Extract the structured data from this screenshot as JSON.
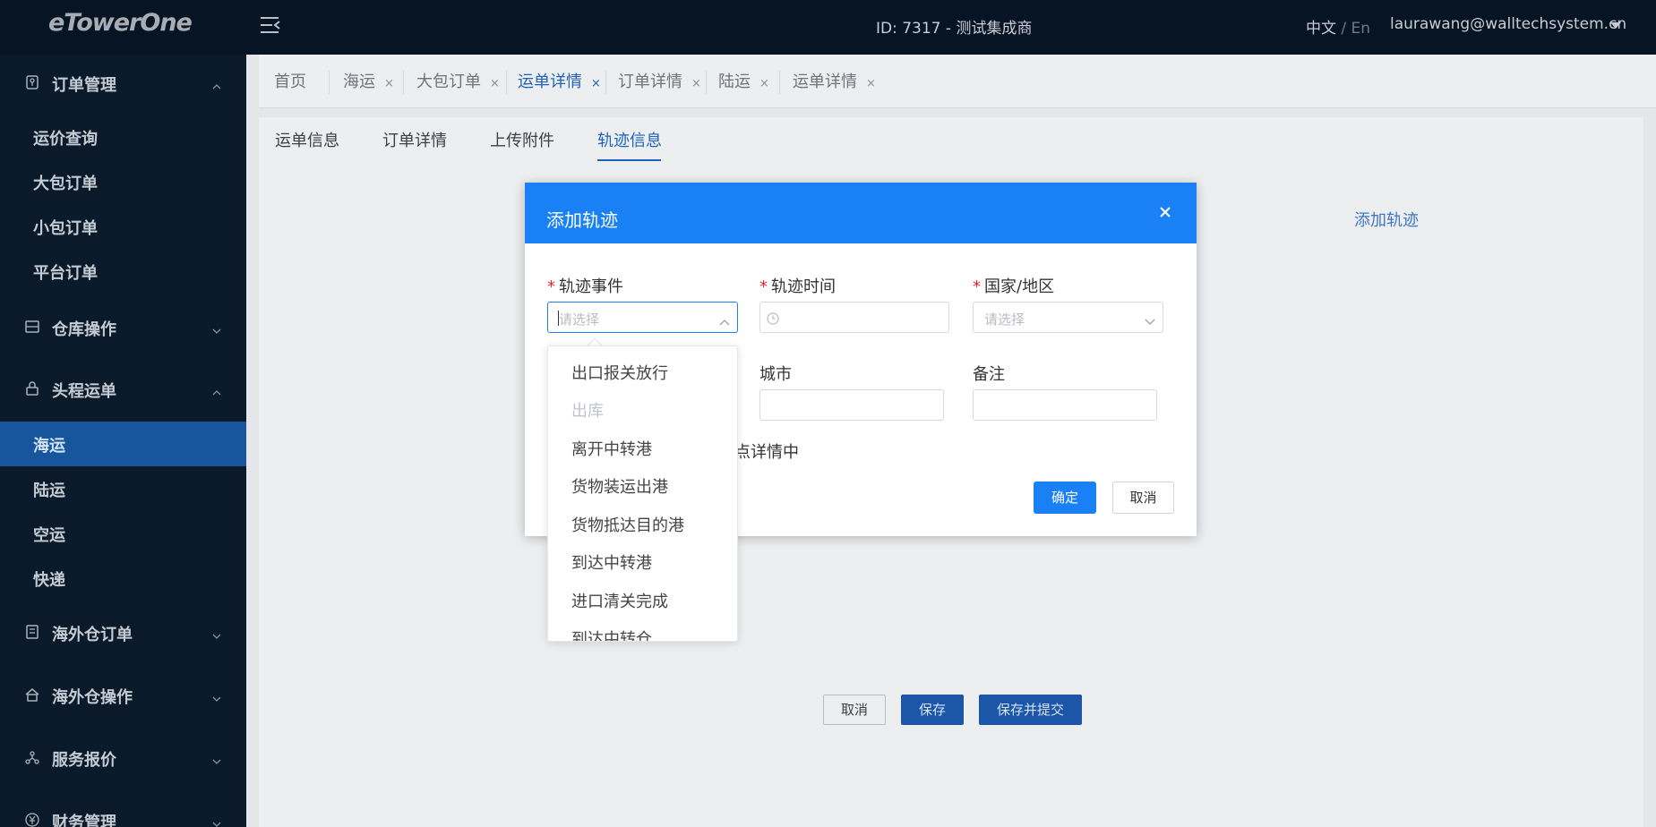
{
  "header": {
    "logo": "eTowerOne",
    "system_id": "ID: 7317 - 测试集成商",
    "lang_zh": "中文",
    "lang_sep": " / ",
    "lang_en": "En",
    "user_email": "laurawang@walltechsystem.cn"
  },
  "sidebar": {
    "groups": [
      {
        "label": "订单管理",
        "icon": "order-icon",
        "expanded": true
      },
      {
        "label": "仓库操作",
        "icon": "warehouse-icon",
        "expanded": false
      },
      {
        "label": "头程运单",
        "icon": "lock-icon",
        "expanded": true
      },
      {
        "label": "海外仓订单",
        "icon": "receipt-icon",
        "expanded": false
      },
      {
        "label": "海外仓操作",
        "icon": "house-icon",
        "expanded": false
      },
      {
        "label": "服务报价",
        "icon": "network-icon",
        "expanded": false
      },
      {
        "label": "财务管理",
        "icon": "yen-icon",
        "expanded": false
      }
    ],
    "order_items": [
      "运价查询",
      "大包订单",
      "小包订单",
      "平台订单"
    ],
    "transport_items": [
      "海运",
      "陆运",
      "空运",
      "快递"
    ],
    "active_item": "海运"
  },
  "tabs": [
    {
      "label": "首页",
      "closable": false
    },
    {
      "label": "海运",
      "closable": true
    },
    {
      "label": "大包订单",
      "closable": true
    },
    {
      "label": "运单详情",
      "closable": true,
      "active": true
    },
    {
      "label": "订单详情",
      "closable": true
    },
    {
      "label": "陆运",
      "closable": true
    },
    {
      "label": "运单详情",
      "closable": true
    }
  ],
  "tab_close_glyph": "×",
  "subtabs": [
    "运单信息",
    "订单详情",
    "上传附件",
    "轨迹信息"
  ],
  "active_subtab": "轨迹信息",
  "add_track_link": "添加轨迹",
  "footer_buttons": {
    "cancel": "取消",
    "save": "保存",
    "save_submit": "保存并提交"
  },
  "modal": {
    "title": "添加轨迹",
    "fields": {
      "event": {
        "label": "轨迹事件",
        "required": true,
        "placeholder": "请选择"
      },
      "time": {
        "label": "轨迹时间",
        "required": true
      },
      "country": {
        "label": "国家/地区",
        "required": true,
        "placeholder": "请选择"
      },
      "city": {
        "label": "城市"
      },
      "remark": {
        "label": "备注"
      }
    },
    "required_mark": "*",
    "partial_text": "点详情中",
    "confirm": "确定",
    "cancel": "取消"
  },
  "event_options": [
    {
      "label": "出口报关放行",
      "disabled": false
    },
    {
      "label": "出库",
      "disabled": true
    },
    {
      "label": "离开中转港",
      "disabled": false
    },
    {
      "label": "货物装运出港",
      "disabled": false
    },
    {
      "label": "货物抵达目的港",
      "disabled": false
    },
    {
      "label": "到达中转港",
      "disabled": false
    },
    {
      "label": "进口清关完成",
      "disabled": false
    },
    {
      "label": "到达中转仓",
      "disabled": false
    }
  ],
  "colors": {
    "primary": "#1a80f5",
    "sidebar_bg": "#0b1a2b",
    "topbar_bg": "#061424",
    "active_item_bg": "#17569c",
    "required": "#f5222d"
  }
}
